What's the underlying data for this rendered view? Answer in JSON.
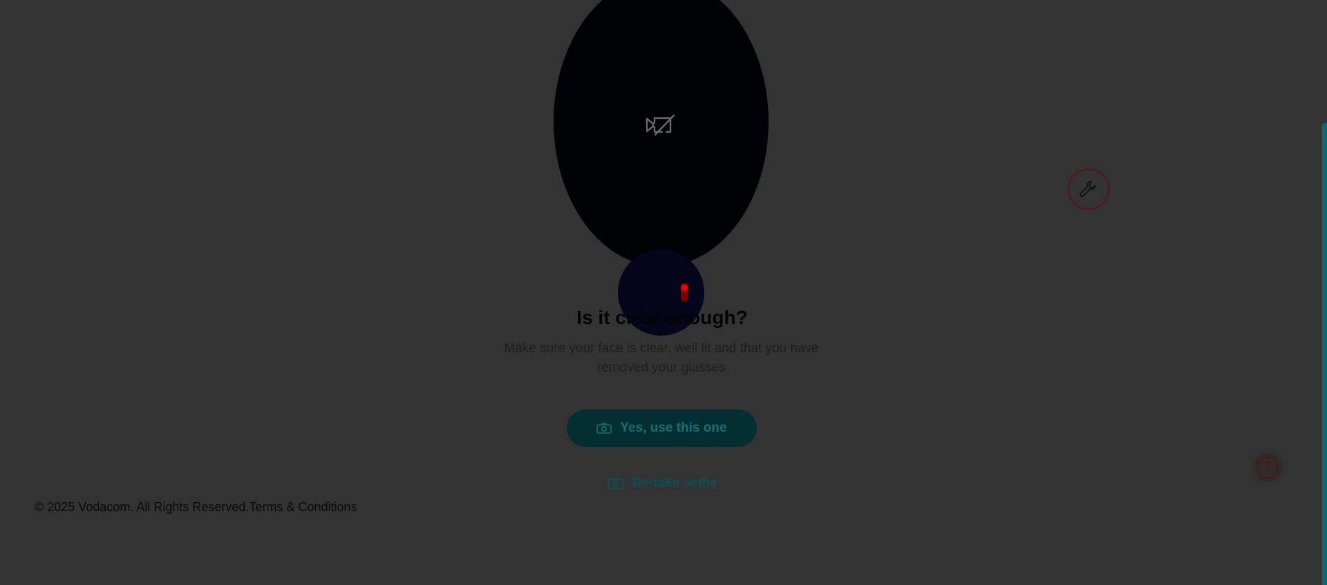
{
  "camera": {
    "status_icon": "camera-off-icon"
  },
  "loading": {
    "indicator_icon": "spinner-icon"
  },
  "review": {
    "heading": "Is it clear enough?",
    "instructions": "Make sure your face is clear, well lit and that you have removed your glasses"
  },
  "actions": {
    "confirm_label": "Yes, use this one",
    "confirm_icon": "camera-icon",
    "retake_label": "Re-take selfie",
    "retake_icon": "camera-retake-icon"
  },
  "footer": {
    "copyright": "© 2025 Vodacom. All Rights Reserved.",
    "terms_link": "Terms & Conditions"
  },
  "floating": {
    "tool_icon": "wrench-icon",
    "help_label": "?"
  },
  "colors": {
    "overlay_background": "#333333",
    "brand_teal": "#0b6a72",
    "brand_red": "#e60000"
  }
}
